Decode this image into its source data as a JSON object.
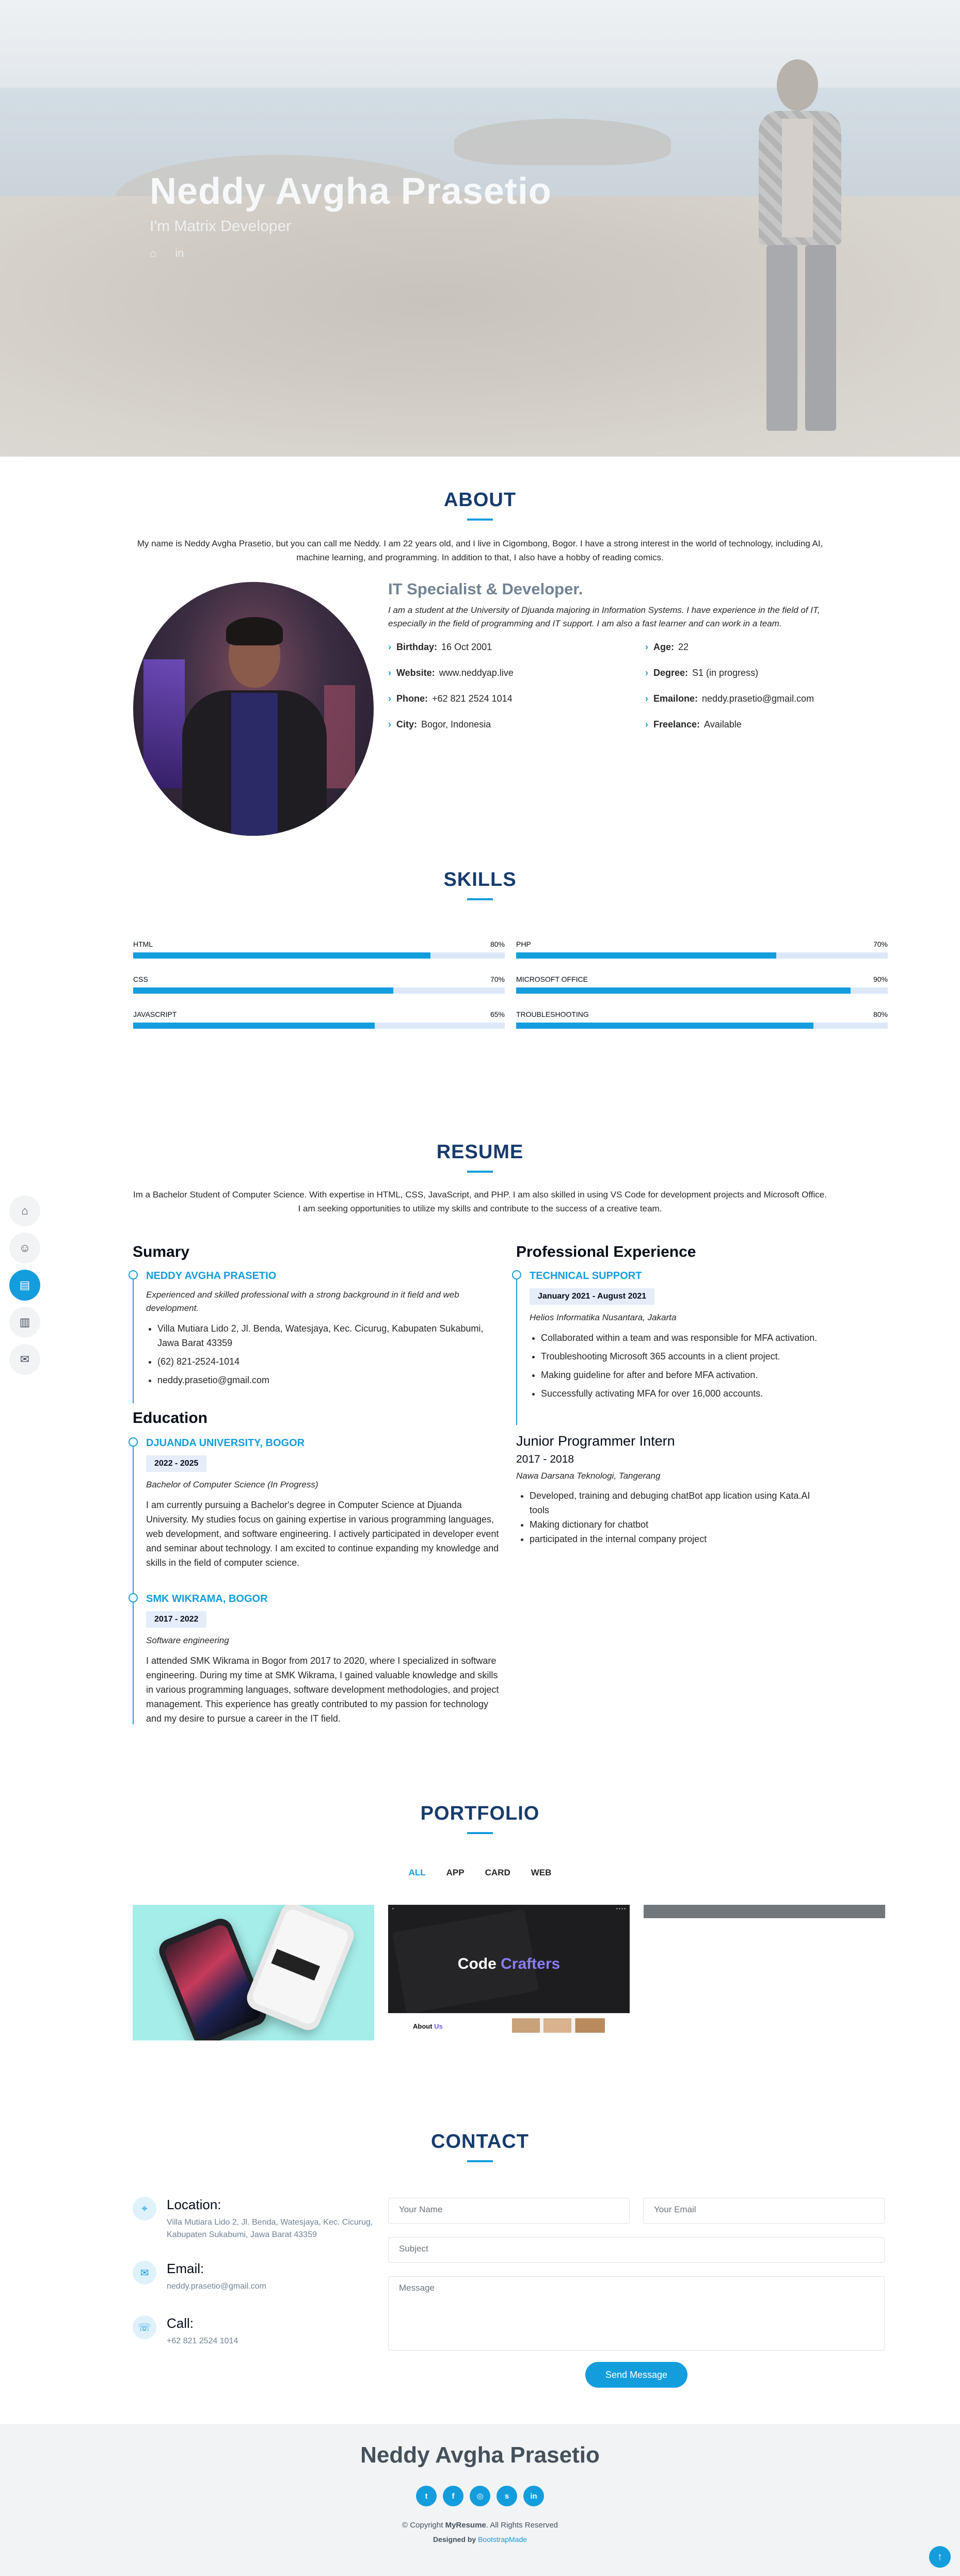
{
  "hero": {
    "name": "Neddy Avgha Prasetio",
    "role": "I'm Matrix Developer",
    "social": [
      {
        "icon": "github-icon",
        "glyph": "⌂"
      },
      {
        "icon": "linkedin-icon",
        "glyph": "in"
      }
    ]
  },
  "about": {
    "title": "ABOUT",
    "intro": "My name is Neddy Avgha Prasetio, but you can call me Neddy. I am 22 years old, and I live in Cigombong, Bogor. I have a strong interest in the world of technology, including AI, machine learning, and programming. In addition to that, I also have a hobby of reading comics.",
    "heading": "IT Specialist & Developer.",
    "lead": "I am a student at the University of Djuanda majoring in Information Systems. I have experience in the field of IT, especially in the field of programming and IT support. I am also a fast learner and can work in a team.",
    "info": [
      {
        "label": "Birthday:",
        "value": "16 Oct 2001"
      },
      {
        "label": "Age:",
        "value": "22"
      },
      {
        "label": "Website:",
        "value": "www.neddyap.live"
      },
      {
        "label": "Degree:",
        "value": "S1 (in progress)"
      },
      {
        "label": "Phone:",
        "value": "+62 821 2524 1014"
      },
      {
        "label": "Emailone:",
        "value": "neddy.prasetio@gmail.com"
      },
      {
        "label": "City:",
        "value": "Bogor, Indonesia"
      },
      {
        "label": "Freelance:",
        "value": "Available"
      }
    ]
  },
  "skills": {
    "title": "SKILLS",
    "items": [
      {
        "name": "HTML",
        "value": "80%",
        "level": 0.8
      },
      {
        "name": "PHP",
        "value": "70%",
        "level": 0.7
      },
      {
        "name": "CSS",
        "value": "70%",
        "level": 0.7
      },
      {
        "name": "MICROSOFT OFFICE",
        "value": "90%",
        "level": 0.9
      },
      {
        "name": "JAVASCRIPT",
        "value": "65%",
        "level": 0.65
      },
      {
        "name": "TROUBLESHOOTING",
        "value": "80%",
        "level": 0.8
      }
    ]
  },
  "sidenav": {
    "items": [
      {
        "icon": "home-icon",
        "glyph": "⌂",
        "active": false
      },
      {
        "icon": "person-icon",
        "glyph": "☺",
        "active": false
      },
      {
        "icon": "file-icon",
        "glyph": "▤",
        "active": true
      },
      {
        "icon": "book-icon",
        "glyph": "▥",
        "active": false
      },
      {
        "icon": "envelope-icon",
        "glyph": "✉",
        "active": false
      }
    ]
  },
  "resume": {
    "title": "RESUME",
    "intro": "Im a Bachelor Student of Computer Science. With expertise in HTML, CSS, JavaScript, and PHP. I am also skilled in using VS Code for development projects and Microsoft Office. I am seeking opportunities to utilize my skills and contribute to the success of a creative team.",
    "summary_title": "Sumary",
    "summary": {
      "name": "NEDDY AVGHA PRASETIO",
      "desc": "Experienced and skilled professional with a strong background in it field and web development.",
      "list": [
        "Villa Mutiara Lido 2, Jl. Benda, Watesjaya, Kec. Cicurug, Kabupaten Sukabumi, Jawa Barat 43359",
        "(62) 821-2524-1014",
        "neddy.prasetio@gmail.com"
      ]
    },
    "education_title": "Education",
    "education": [
      {
        "school": "DJUANDA UNIVERSITY, BOGOR",
        "date": "2022 - 2025",
        "degree": "Bachelor of Computer Science (In Progress)",
        "text": "I am currently pursuing a Bachelor's degree in Computer Science at Djuanda University. My studies focus on gaining expertise in various programming languages, web development, and software engineering. I actively participated in developer event and seminar about technology. I am excited to continue expanding my knowledge and skills in the field of computer science."
      },
      {
        "school": "SMK WIKRAMA, BOGOR",
        "date": "2017 - 2022",
        "degree": "Software engineering",
        "text": "I attended SMK Wikrama in Bogor from 2017 to 2020, where I specialized in software engineering. During my time at SMK Wikrama, I gained valuable knowledge and skills in various programming languages, software development methodologies, and project management. This experience has greatly contributed to my passion for technology and my desire to pursue a career in the IT field."
      }
    ],
    "experience_title": "Professional Experience",
    "experience": {
      "role": "TECHNICAL SUPPORT",
      "date": "January 2021 - August 2021",
      "company": "Helios Informatika Nusantara, Jakarta",
      "list": [
        "Collaborated within a team and was responsible for MFA activation.",
        "Troubleshooting Microsoft 365 accounts in a client project.",
        "Making guideline for after and before MFA activation.",
        "Successfully activating MFA for over 16,000 accounts."
      ]
    },
    "junior": {
      "role": "Junior Programmer Intern",
      "years": "2017 - 2018",
      "company": "Nawa Darsana Teknologi, Tangerang",
      "list": [
        "Developed, training and debuging chatBot app lication using Kata.AI tools",
        "Making dictionary for chatbot",
        "participated in the internal company project"
      ]
    }
  },
  "portfolio": {
    "title": "PORTFOLIO",
    "filters": [
      "ALL",
      "APP",
      "CARD",
      "WEB"
    ],
    "card2_title_a": "Code ",
    "card2_title_b": "Crafters",
    "card2_about_a": "About ",
    "card2_about_b": "Us"
  },
  "contact": {
    "title": "CONTACT",
    "location_label": "Location:",
    "location": "Villa Mutiara Lido 2, Jl. Benda, Watesjaya, Kec. Cicurug, Kabupaten Sukabumi, Jawa Barat 43359",
    "email_label": "Email:",
    "email": "neddy.prasetio@gmail.com",
    "call_label": "Call:",
    "call": "+62 821 2524 1014",
    "name_placeholder": "Your Name",
    "email_placeholder": "Your Email",
    "subject_placeholder": "Subject",
    "message_placeholder": "Message",
    "send": "Send Message"
  },
  "footer": {
    "name": "Neddy Avgha Prasetio",
    "social": [
      {
        "icon": "twitter-icon",
        "glyph": "t"
      },
      {
        "icon": "facebook-icon",
        "glyph": "f"
      },
      {
        "icon": "instagram-icon",
        "glyph": "◎"
      },
      {
        "icon": "skype-icon",
        "glyph": "s"
      },
      {
        "icon": "linkedin-icon",
        "glyph": "in"
      }
    ],
    "copyright_a": "© Copyright ",
    "copyright_b": "MyResume",
    "copyright_c": ". All Rights Reserved",
    "designed_a": "Designed by ",
    "designed_b": "BootstrapMade"
  },
  "colors": {
    "accent": "#149ddd",
    "title": "#173b6c",
    "text": "#272829"
  }
}
